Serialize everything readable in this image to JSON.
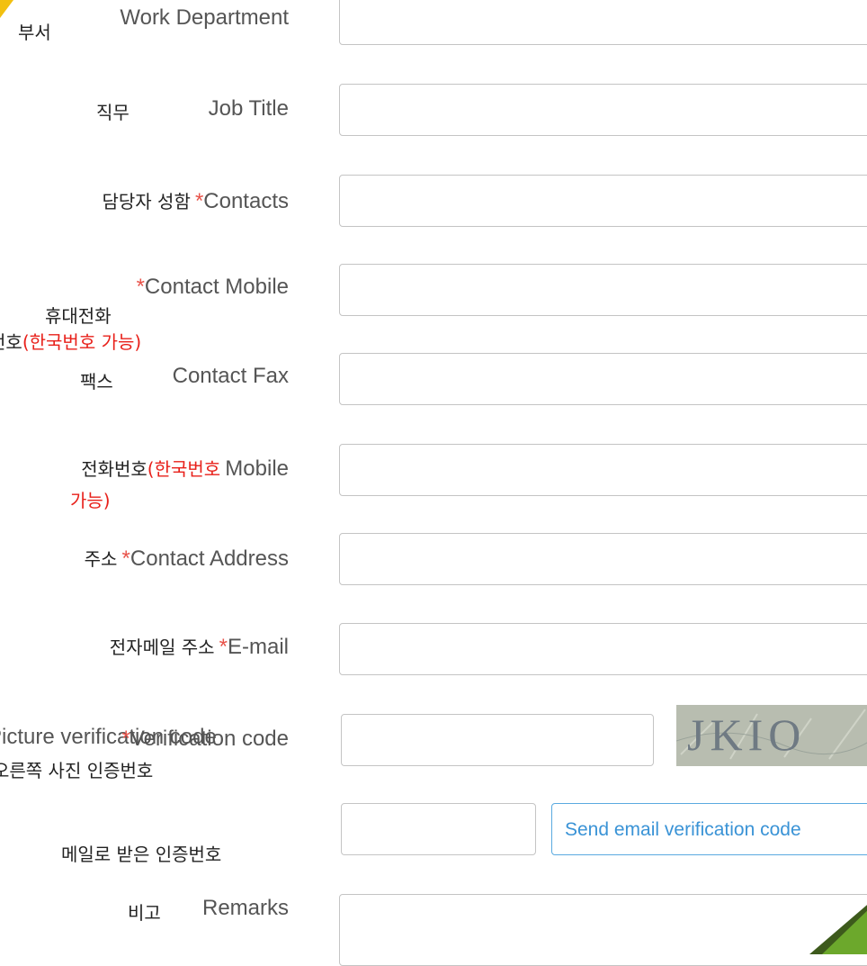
{
  "fields": {
    "department": {
      "ko": "부서",
      "en": "Work Department",
      "value": ""
    },
    "job_title": {
      "ko": "직무",
      "en": "Job Title",
      "value": ""
    },
    "contacts": {
      "ko": "담당자 성함",
      "star": "*",
      "en": "Contacts",
      "value": ""
    },
    "mobile": {
      "star": "*",
      "en": "Contact Mobile",
      "ko": "휴대전화",
      "ko_line2": "번호",
      "ko_note": "(한국번호 가능)",
      "value": ""
    },
    "fax": {
      "ko": "팩스",
      "en": "Contact Fax",
      "value": ""
    },
    "phone": {
      "ko": "전화번호",
      "ko_note": "(한국번호",
      "en": "Mobile",
      "ko_note2": "가능)",
      "value": ""
    },
    "address": {
      "ko": "주소",
      "star": "*",
      "en": "Contact Address",
      "value": ""
    },
    "email": {
      "ko": "전자메일 주소",
      "star": "*",
      "en": "E-mail",
      "value": ""
    },
    "picture_code": {
      "en": "Picture verification code",
      "ko": "오른쪽 사진 인증번호",
      "value": "",
      "captcha_text": "JKIO"
    },
    "email_code": {
      "star": "*",
      "en": "Verification code",
      "ko": "메일로 받은 인증번호",
      "value": "",
      "button": "Send email verification code"
    },
    "remarks": {
      "ko": "비고",
      "en": "Remarks",
      "value": ""
    }
  },
  "colors": {
    "required": "#e8534a",
    "note_red": "#e8201a",
    "button_blue": "#3a93d6",
    "label_gray": "#555555"
  }
}
